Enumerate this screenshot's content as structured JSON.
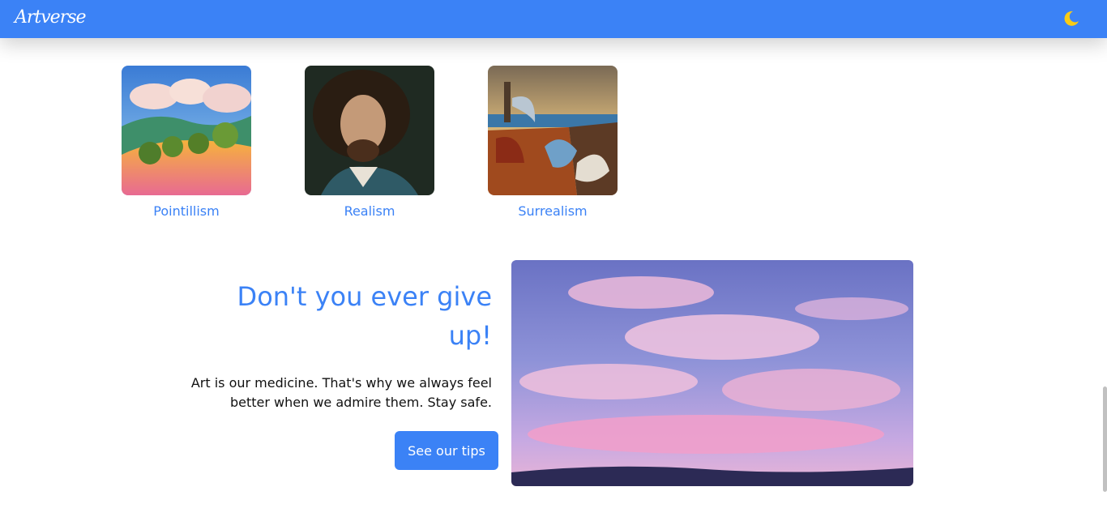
{
  "navbar": {
    "logo_text": "Artverse",
    "theme_icon": "moon-icon",
    "color": "#3b82f6"
  },
  "styles": {
    "items": [
      {
        "label": "Pointillism"
      },
      {
        "label": "Realism"
      },
      {
        "label": "Surrealism"
      }
    ]
  },
  "hero": {
    "title": "Don't you ever give up!",
    "text": "Art is our medicine. That's why we always feel better when we admire them. Stay safe.",
    "button_label": "See our tips"
  }
}
